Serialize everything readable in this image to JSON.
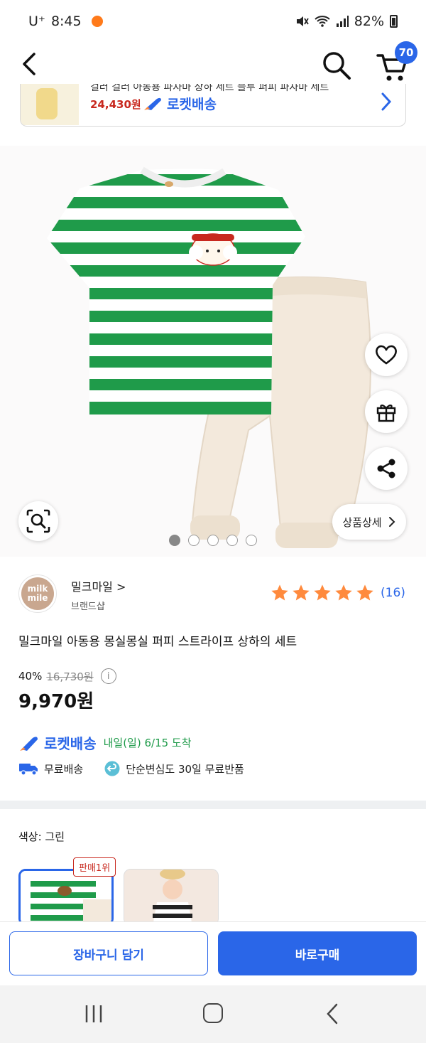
{
  "status": {
    "carrier": "U⁺",
    "time": "8:45",
    "battery": "82%"
  },
  "nav": {
    "cart_count": "70"
  },
  "recommend": {
    "cut_text": "걸러 걸러 아동용 파자마 상하 세트 블루 퍼피 파자마 세트",
    "price": "24,430원",
    "rocket_label": "로켓배송"
  },
  "hero": {
    "detail_label": "상품상세",
    "dots_total": 5,
    "dots_active": 1
  },
  "brand": {
    "logo_top": "milk",
    "logo_bottom": "mile",
    "name": "밀크마일",
    "shop_label": "브랜드샵"
  },
  "rating": {
    "stars": 5,
    "count": "(16)"
  },
  "product": {
    "title": "밀크마일 아동용 몽실몽실 퍼피 스트라이프 상하의 세트"
  },
  "pricing": {
    "discount": "40%",
    "original": "16,730원",
    "info": "i",
    "price": "9,970원"
  },
  "delivery": {
    "rocket_label": "로켓배송",
    "arrival": "내일(일) 6/15 도착",
    "free_shipping": "무료배송",
    "return_info": "단순변심도 30일 무료반품"
  },
  "options": {
    "color_label": "색상: 그린",
    "best_badge": "판매1위"
  },
  "actions": {
    "add_to_cart": "장바구니 담기",
    "buy_now": "바로구매"
  },
  "colors": {
    "accent": "#2a66e8",
    "green_stripe": "#1f9b4a",
    "price_red": "#c8281e",
    "star": "#ff8a3d"
  }
}
